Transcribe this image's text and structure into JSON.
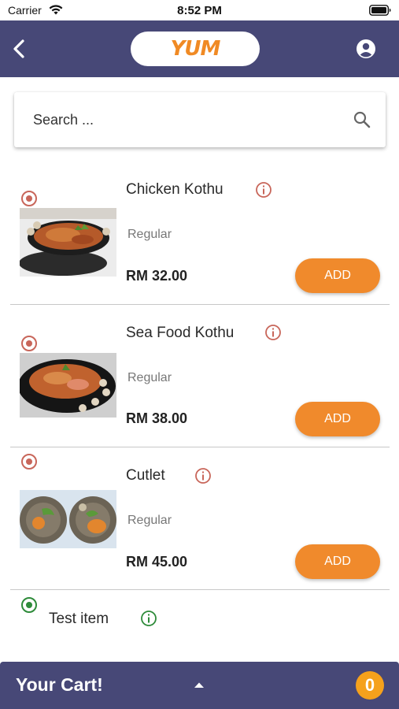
{
  "status_bar": {
    "carrier": "Carrier",
    "time": "8:52 PM",
    "icons": [
      "wifi-icon",
      "battery-icon"
    ]
  },
  "app_bar": {
    "logo_text": "YUM",
    "icons": [
      "back-arrow-icon",
      "account-circle-icon"
    ],
    "background_color": "#474877",
    "logo_color": "#f08a24"
  },
  "search": {
    "placeholder": "Search ...",
    "value": "",
    "icon": "search-icon"
  },
  "menu": {
    "items": [
      {
        "name": "Chicken Kothu",
        "variant": "Regular",
        "price": "RM 32.00",
        "add_label": "ADD",
        "image": "fried-rice-dish-image",
        "indicator_color": "#c8665a"
      },
      {
        "name": "Sea Food Kothu",
        "variant": "Regular",
        "price": "RM 38.00",
        "add_label": "ADD",
        "image": "seafood-rice-dish-image",
        "indicator_color": "#c8665a"
      },
      {
        "name": "Cutlet",
        "variant": "Regular",
        "price": "RM 45.00",
        "add_label": "ADD",
        "image": "cutlet-plates-image",
        "indicator_color": "#c8665a"
      },
      {
        "name": "Test item",
        "indicator_color": "#2e8b3a"
      }
    ]
  },
  "cart": {
    "title": "Your Cart!",
    "count": "0",
    "icon": "caret-up-icon",
    "badge_color": "#f5a11c"
  },
  "colors": {
    "accent": "#f08a2c",
    "non_veg": "#c8665a",
    "veg": "#2e8b3a"
  }
}
